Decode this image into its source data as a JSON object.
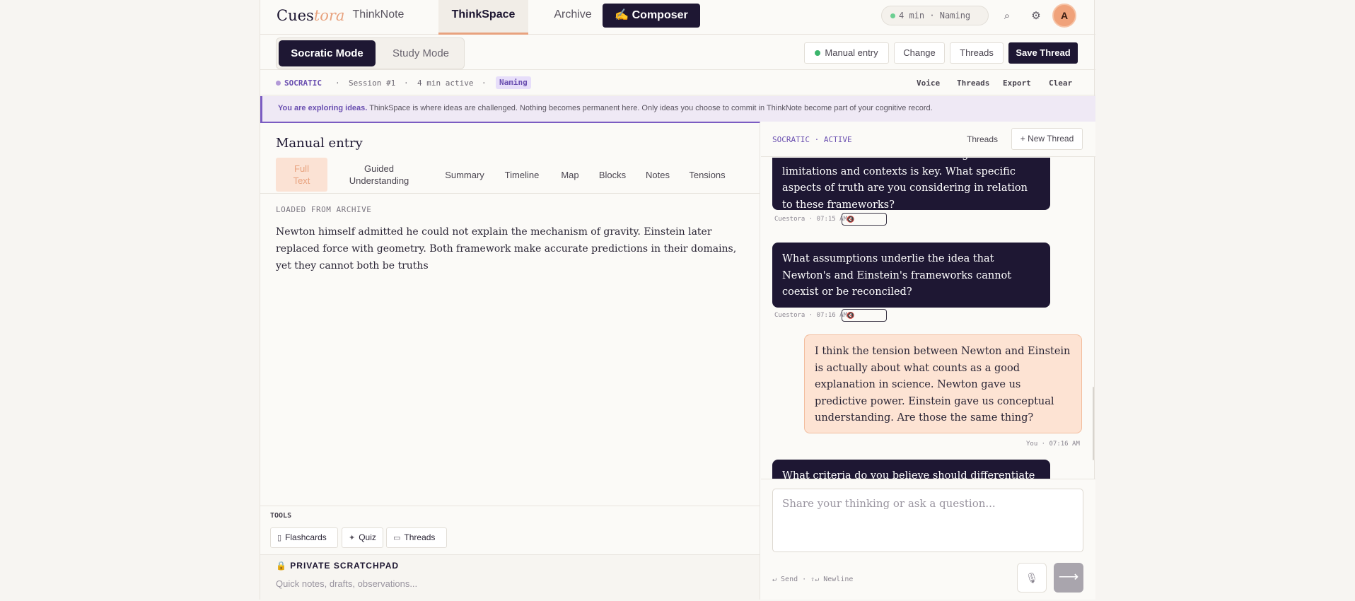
{
  "nav": {
    "logo_main": "Cues",
    "logo_accent": "tora",
    "tabs": [
      "ThinkNote",
      "ThinkSpace",
      "Archive"
    ],
    "composer_label": "✍ Composer",
    "timer_text": "4 min · Naming",
    "avatar_initial": "A"
  },
  "mode": {
    "socratic_label": "Socratic Mode",
    "study_label": "Study Mode",
    "manual_entry_label": "Manual entry",
    "change_label": "Change",
    "threads_label": "Threads",
    "save_label": "Save Thread"
  },
  "status": {
    "mode": "SOCRATIC",
    "session": "Session #1",
    "active": "4 min active",
    "tag": "Naming",
    "sep": "·",
    "actions": [
      "Voice",
      "Threads",
      "Export",
      "Clear"
    ]
  },
  "banner": {
    "bold": "You are exploring ideas.",
    "text": " ThinkSpace is where ideas are challenged. Nothing becomes permanent here. Only ideas you choose to commit in ThinkNote become part of your cognitive record."
  },
  "doc": {
    "title": "Manual entry",
    "tabs": [
      "Full\nText",
      "Guided\nUnderstanding",
      "Summary",
      "Timeline",
      "Map",
      "Blocks",
      "Notes",
      "Tensions"
    ],
    "loaded_label": "LOADED FROM ARCHIVE",
    "body": "Newton himself admitted he could not explain the mechanism of gravity. Einstein later replaced force with geometry. Both framework make accurate predictions in their domains, yet they cannot both be truths"
  },
  "tools": {
    "label": "TOOLS",
    "flashcards": "Flashcards",
    "quiz": "Quiz",
    "threads": "Threads"
  },
  "scratchpad": {
    "title": "🔒 PRIVATE SCRATCHPAD",
    "placeholder": "Quick notes, drafts, observations..."
  },
  "chat": {
    "label": "SOCRATIC · ACTIVE",
    "threads_label": "Threads",
    "new_thread_label": "+ New Thread",
    "messages": [
      {
        "role": "ai",
        "text": "different conditions. Understanding their limitations and contexts is key. What specific aspects of truth are you considering in relation to these frameworks?",
        "meta": "Cuestora · 07:15 AM"
      },
      {
        "role": "ai",
        "text": "What assumptions underlie the idea that Newton's and Einstein's frameworks cannot coexist or be reconciled?",
        "meta": "Cuestora · 07:16 AM"
      },
      {
        "role": "user",
        "text": "I think the tension between Newton and Einstein is actually about what counts as a good explanation in science. Newton gave us predictive power. Einstein gave us conceptual understanding. Are those the same thing?",
        "meta": "You · 07:16 AM"
      },
      {
        "role": "ai",
        "text": "What criteria do you believe should differentiate a",
        "meta": ""
      }
    ],
    "speaker_glyph": "🔇",
    "input_placeholder": "Share your thinking or ask a question...",
    "hint": "↵ Send · ⇧↵ Newline",
    "mic_glyph": "🎙",
    "send_glyph": "⟶"
  }
}
